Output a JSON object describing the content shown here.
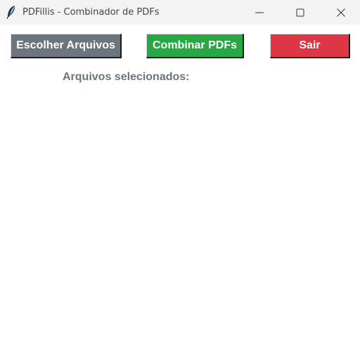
{
  "window": {
    "title": "PDFillis - Combinador de PDFs",
    "icon": "feather-icon"
  },
  "buttons": {
    "choose_label": "Escolher Arquivos",
    "merge_label": "Combinar PDFs",
    "exit_label": "Sair"
  },
  "files": {
    "label": "Arquivos selecionados:",
    "items": []
  },
  "colors": {
    "choose": "#6c757d",
    "merge": "#28a745",
    "exit": "#dc3545",
    "label": "#6c757d"
  }
}
